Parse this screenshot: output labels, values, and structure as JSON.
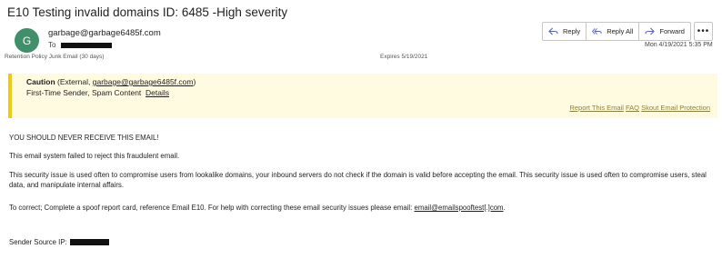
{
  "email": {
    "subject": "E10 Testing invalid domains ID: 6485 -High severity",
    "avatar_initial": "G",
    "sender": "garbage@garbage6485f.com",
    "to_label": "To",
    "retention": "Retention Policy  Junk Email (30 days)",
    "expires": "Expires  5/19/2021",
    "date": "Mon 4/19/2021 5:35 PM"
  },
  "toolbar": {
    "reply_label": "Reply",
    "reply_all_label": "Reply All",
    "forward_label": "Forward",
    "more_label": "•••"
  },
  "banner": {
    "caution_label": "Caution",
    "caution_pre": " (External, ",
    "caution_address": "garbage@garbage6485f.com",
    "caution_post": ")",
    "reasons": "First-Time Sender, Spam Content",
    "details_label": "Details",
    "report_label": "Report This Email",
    "faq_label": "FAQ",
    "protection_label": "Skout Email Protection"
  },
  "body": {
    "line1": "YOU SHOULD NEVER RECEIVE THIS EMAIL!",
    "line2": "This email system failed to reject this fraudulent email.",
    "line3": "This security issue is used often to compromise users from lookalike domains, your inbound servers do not check if the domain is valid before accepting the email. This security issue is used often to compromise users, steal data, and manipulate internal affairs.",
    "line4_pre": "To correct; Complete a spoof report card, reference Email E10.  For help with correcting these email security issues please email: ",
    "line4_link": "email@emailspooftest[.]com",
    "line4_post": ".",
    "source_label": "Sender Source IP:"
  },
  "colors": {
    "avatar": "#3f8f6a",
    "banner_bg": "#fffbe0",
    "banner_border": "#f2c811",
    "action_icon": "#5b5fc7"
  }
}
